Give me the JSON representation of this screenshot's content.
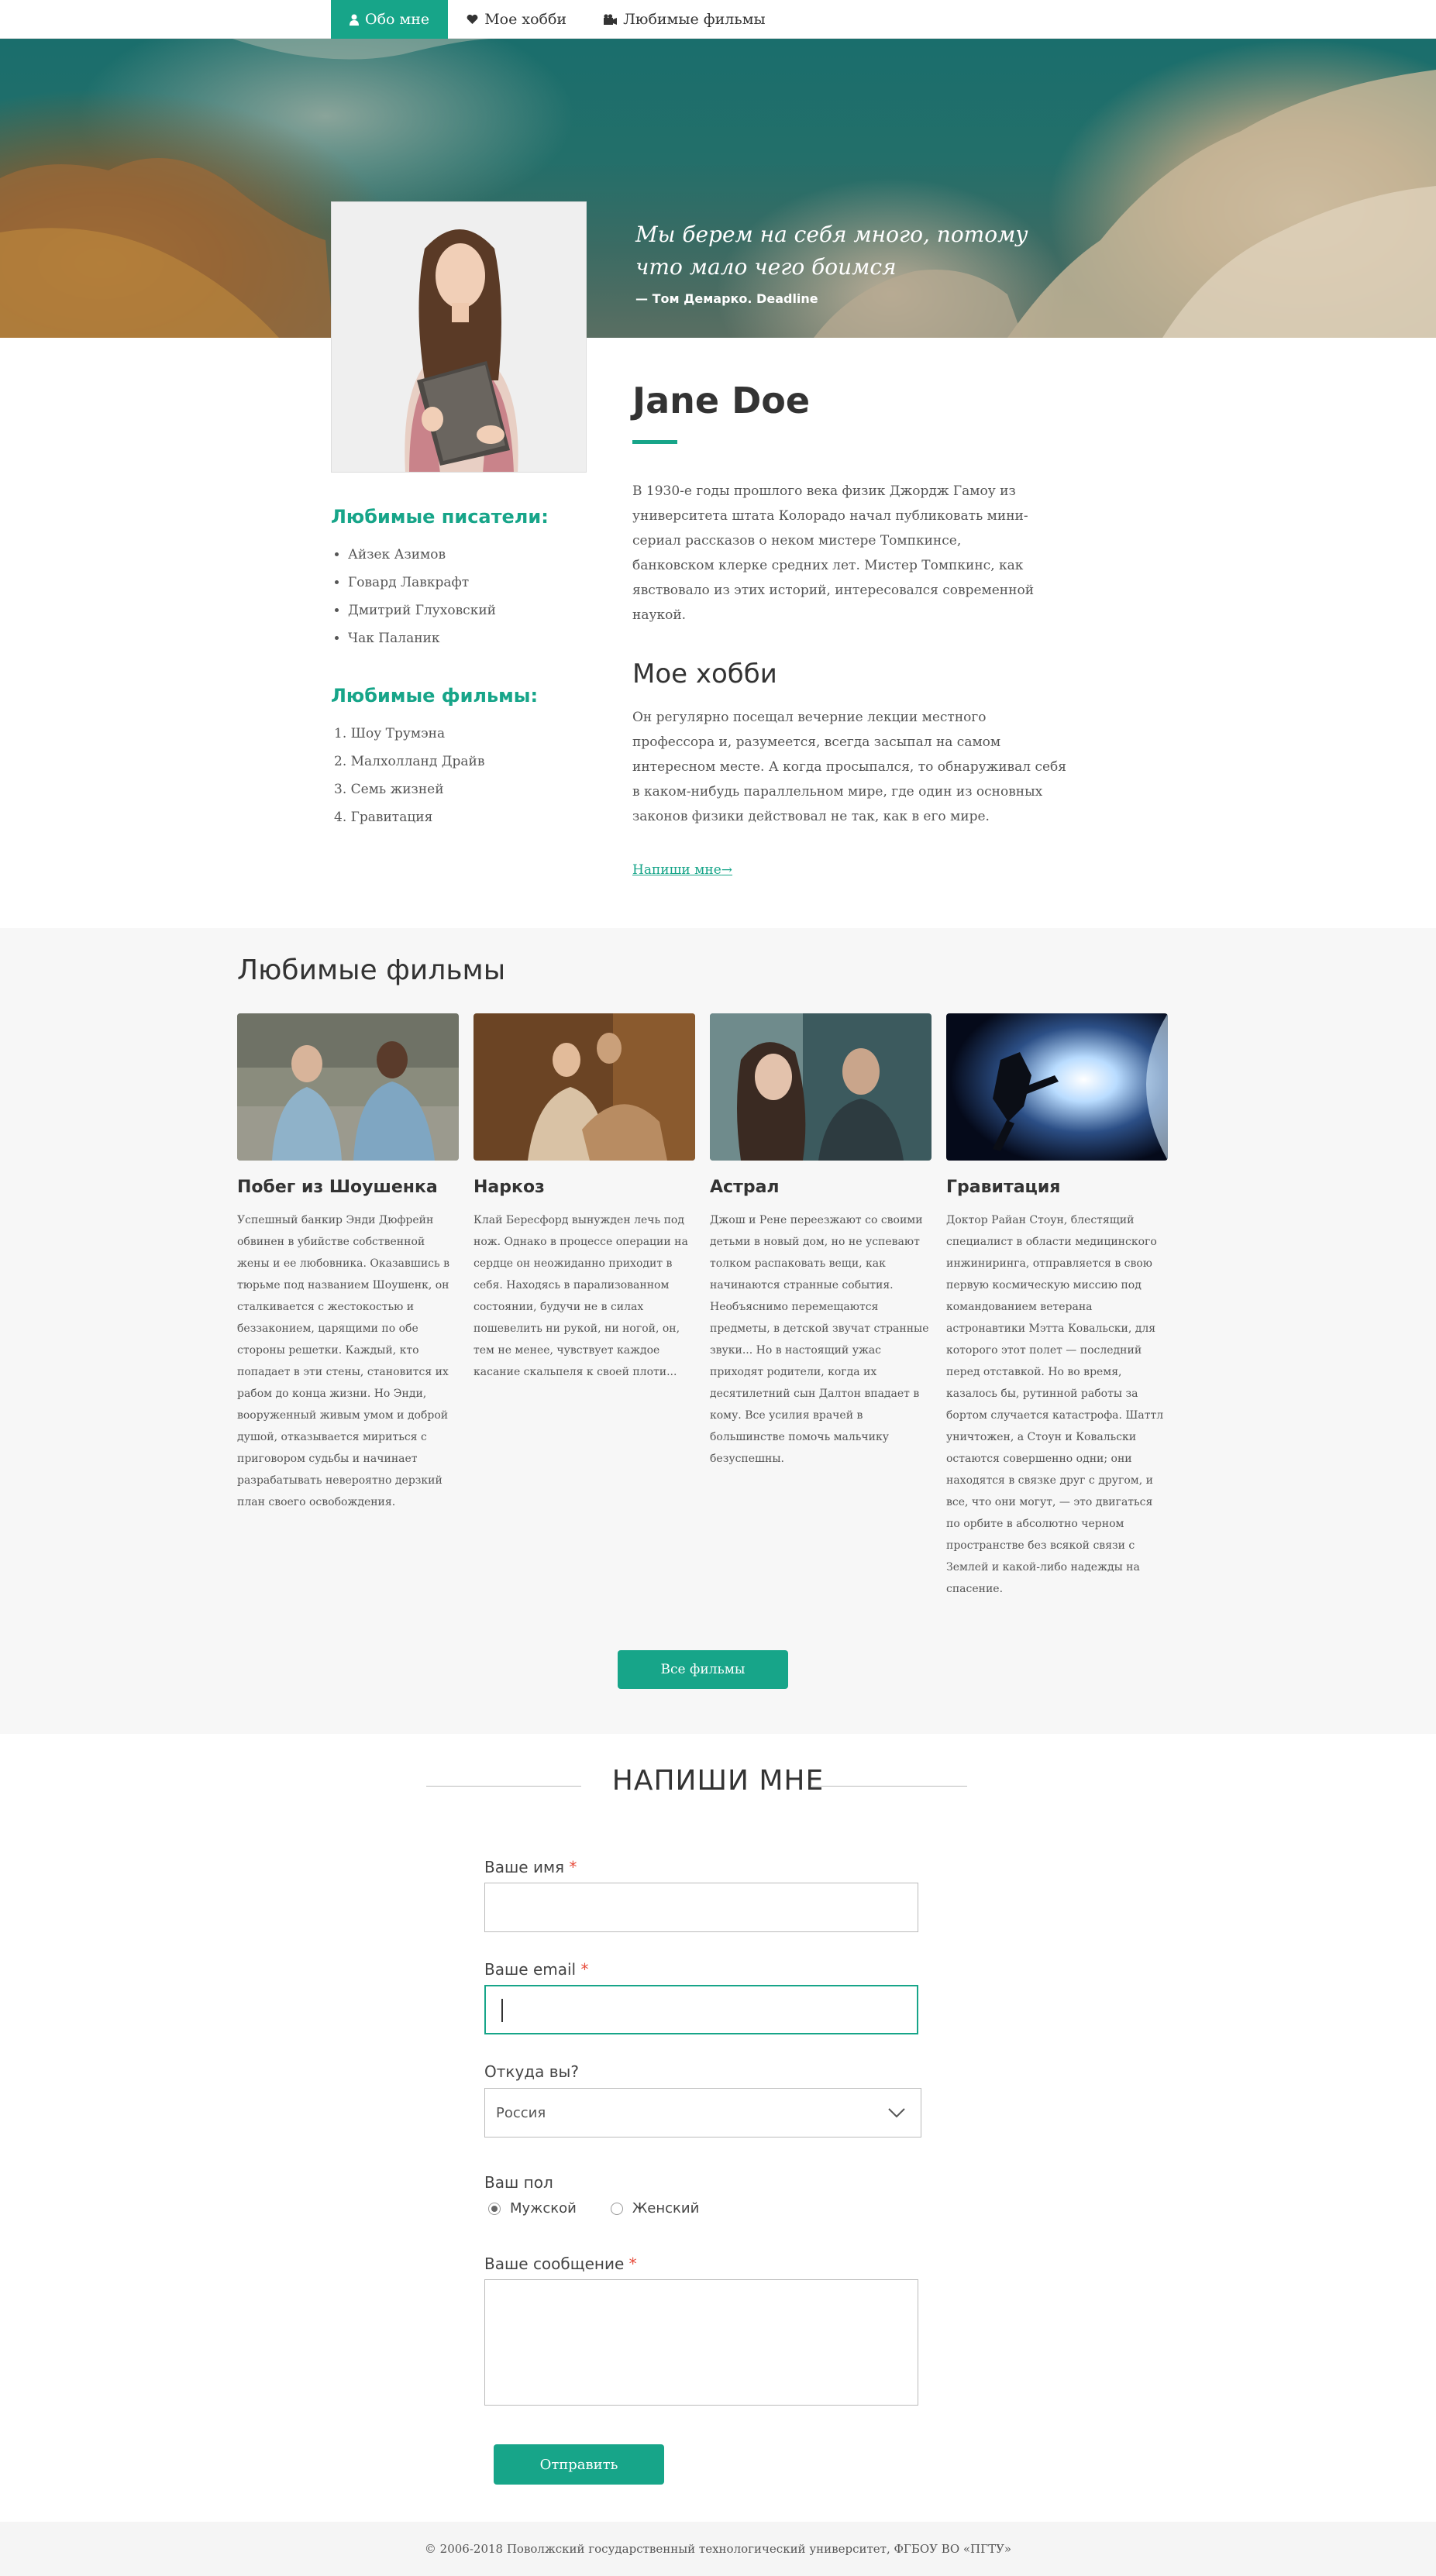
{
  "nav": {
    "items": [
      {
        "label": "Обо мне",
        "icon": "user-icon",
        "active": true
      },
      {
        "label": "Мое хобби",
        "icon": "heart-icon",
        "active": false
      },
      {
        "label": "Любимые фильмы",
        "icon": "film-icon",
        "active": false
      }
    ]
  },
  "hero": {
    "quote": "Мы берем на себя много, потому что мало чего боимся",
    "author": "— Том Демарко. Deadline"
  },
  "profile": {
    "name": "Jane Doe",
    "bio": "В 1930-е годы прошлого века физик Джордж Гамоу из университета штата Колорадо начал публиковать мини-сериал рассказов о неком мистере Томпкинсе, банковском клерке средних лет. Мистер Томпкинс, как явствовало из этих историй, интересовался современной наукой.",
    "hobby_title": "Мое хобби",
    "hobby_text": "Он регулярно посещал вечерние лекции местного профессора и, разумеется, всегда засыпал на самом интересном месте. А когда просыпался, то обнаруживал себя в каком-нибудь параллельном мире, где один из основных законов физики действовал не так, как в его мире.",
    "write_link": "Напиши мне",
    "write_arrow": "→"
  },
  "sidebar": {
    "writers_title": "Любимые писатели:",
    "writers": [
      "Айзек Азимов",
      "Говард Лавкрафт",
      "Дмитрий Глуховский",
      "Чак Паланик"
    ],
    "films_title": "Любимые фильмы:",
    "films": [
      "1. Шоу Трумэна",
      "2. Малхолланд Драйв",
      "3. Семь жизней",
      "4. Гравитация"
    ]
  },
  "films": {
    "title": "Любимые фильмы",
    "cards": [
      {
        "title": "Побег из Шоушенка",
        "desc": "Успешный банкир Энди Дюфрейн обвинен в убийстве собственной жены и ее любовника. Оказавшись в тюрьме под названием Шоушенк, он сталкивается с жестокостью и беззаконием, царящими по обе стороны решетки. Каждый, кто попадает в эти стены, становится их рабом до конца жизни. Но Энди, вооруженный живым умом и доброй душой, отказывается мириться с приговором судьбы и начинает разрабатывать невероятно дерзкий план своего освобождения."
      },
      {
        "title": "Наркоз",
        "desc": "Клай Бересфорд вынужден лечь под нож. Однако в процессе операции на сердце он неожиданно приходит в себя. Находясь в парализованном состоянии, будучи не в силах пошевелить ни рукой, ни ногой, он, тем не менее, чувствует каждое касание скальпеля к своей плоти..."
      },
      {
        "title": "Астрал",
        "desc": "Джош и Рене переезжают со своими детьми в новый дом, но не успевают толком распаковать вещи, как начинаются странные события. Необъяснимо перемещаются предметы, в детской звучат странные звуки... Но в настоящий ужас приходят родители, когда их десятилетний сын Далтон впадает в кому. Все усилия врачей в большинстве помочь мальчику безуспешны."
      },
      {
        "title": "Гравитация",
        "desc": "Доктор Райан Стоун, блестящий специалист в области медицинского инжиниринга, отправляется в свою первую космическую миссию под командованием ветерана астронавтики Мэтта Ковальски, для которого этот полет — последний перед отставкой. Но во время, казалось бы, рутинной работы за бортом случается катастрофа. Шаттл уничтожен, а Стоун и Ковальски остаются совершенно одни; они находятся в связке друг с другом, и все, что они могут, — это двигаться по орбите в абсолютно черном пространстве без всякой связи с Землей и какой-либо надежды на спасение."
      }
    ],
    "all_button": "Все фильмы"
  },
  "contact": {
    "title": "НАПИШИ МНЕ",
    "name_label": "Ваше имя",
    "email_label": "Ваше email",
    "required_mark": "*",
    "from_label": "Откуда вы?",
    "from_value": "Россия",
    "gender_label": "Ваш пол",
    "gender_options": [
      "Мужской",
      "Женский"
    ],
    "gender_selected": "Мужской",
    "message_label": "Ваше сообщение",
    "submit": "Отправить"
  },
  "footer": {
    "text": "© 2006-2018 Поволжский государственный технологический университет, ФГБОУ ВО «ПГТУ»"
  },
  "colors": {
    "accent": "#17a589",
    "required": "#e74c3c"
  }
}
